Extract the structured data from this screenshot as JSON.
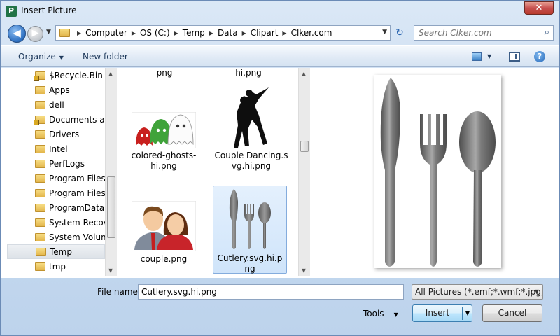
{
  "window": {
    "title": "Insert Picture",
    "app_icon_letter": "P",
    "close_symbol": "✕"
  },
  "nav": {
    "back_symbol": "◀",
    "forward_symbol": "▶",
    "history_symbol": "▼"
  },
  "address": {
    "crumbs": [
      "Computer",
      "OS (C:)",
      "Temp",
      "Data",
      "Clipart",
      "Clker.com"
    ],
    "separator": "▶",
    "dropdown_symbol": "▼",
    "refresh_symbol": "↻"
  },
  "search": {
    "placeholder": "Search Clker.com",
    "icon_symbol": "⌕"
  },
  "toolbar": {
    "organize_label": "Organize",
    "organize_caret": "▼",
    "new_folder_label": "New folder",
    "view_caret": "▼",
    "help_symbol": "?"
  },
  "nav_pane": {
    "items": [
      {
        "label": "$Recycle.Bin",
        "locked": true
      },
      {
        "label": "Apps",
        "locked": false
      },
      {
        "label": "dell",
        "locked": false
      },
      {
        "label": "Documents an",
        "locked": true
      },
      {
        "label": "Drivers",
        "locked": false
      },
      {
        "label": "Intel",
        "locked": false
      },
      {
        "label": "PerfLogs",
        "locked": false
      },
      {
        "label": "Program Files",
        "locked": false
      },
      {
        "label": "Program Files (",
        "locked": false
      },
      {
        "label": "ProgramData",
        "locked": false
      },
      {
        "label": "System Recove",
        "locked": false
      },
      {
        "label": "System Volume",
        "locked": false
      },
      {
        "label": "Temp",
        "locked": false
      },
      {
        "label": "tmp",
        "locked": false
      }
    ],
    "selected": "Temp",
    "scroll_up": "▲",
    "scroll_down": "▼"
  },
  "files": {
    "items": [
      {
        "name": "png",
        "partial": true
      },
      {
        "name": "hi.png",
        "partial": true
      },
      {
        "name": "colored-ghosts-hi.png"
      },
      {
        "name": "Couple Dancing.svg.hi.png"
      },
      {
        "name": "couple.png"
      },
      {
        "name": "Cutlery.svg.hi.png"
      }
    ],
    "selected": "Cutlery.svg.hi.png",
    "scroll_up": "▲",
    "scroll_down": "▼"
  },
  "bottom": {
    "filename_label": "File name:",
    "filename_value": "Cutlery.svg.hi.png",
    "filetype_value": "All Pictures (*.emf;*.wmf;*.jpg;*",
    "filetype_caret": "▼",
    "tools_label": "Tools",
    "tools_caret": "▼",
    "insert_label": "Insert",
    "insert_caret": "▼",
    "cancel_label": "Cancel"
  },
  "colors": {
    "title_bar": "#c9dcf1",
    "close_button": "#c75050",
    "selection_fill": "#cfe4fa",
    "selection_border": "#84acdd",
    "folder": "#e3b64c"
  }
}
